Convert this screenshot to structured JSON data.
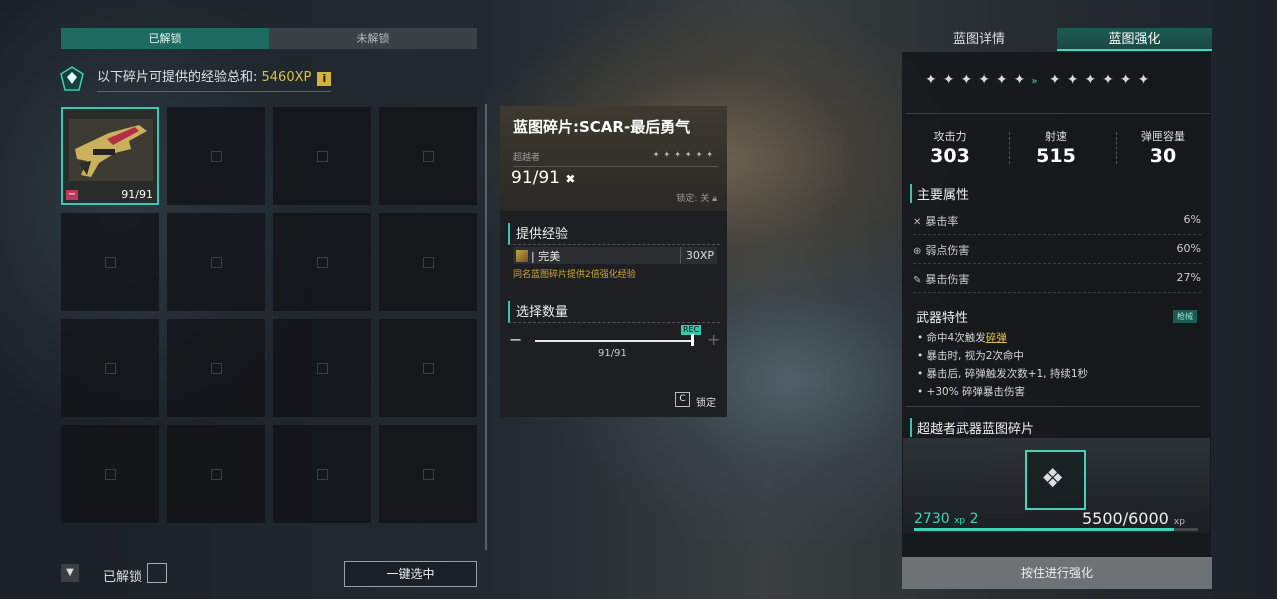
{
  "tabs": {
    "unlocked": "已解锁",
    "locked": "未解锁"
  },
  "xp_summary": {
    "label": "以下碎片可提供的经验总和: ",
    "value": "5460XP",
    "info_icon": "i"
  },
  "grid": {
    "selected_count": "91/91"
  },
  "footer": {
    "filter_icon": "▼",
    "unlocked_label": "已解锁",
    "select_all": "一键选中"
  },
  "card": {
    "title": "蓝图碎片:SCAR-最后勇气",
    "rank": "超越者",
    "count": "91/91",
    "lock_state": "锁定: 关",
    "xp_section": "提供经验",
    "xp_item_name": "完美",
    "xp_item_value": "30XP",
    "xp_note": "同名蓝图碎片提供2倍强化经验",
    "qty_section": "选择数量",
    "rec_tag": "REC",
    "slider_value": "91/91",
    "slider_fraction": 1.0,
    "lock_key": "C",
    "lock_label": "锁定"
  },
  "right": {
    "tab_details": "蓝图详情",
    "tab_enhance": "蓝图强化",
    "stats": [
      {
        "label": "攻击力",
        "value": "303"
      },
      {
        "label": "射速",
        "value": "515"
      },
      {
        "label": "弹匣容量",
        "value": "30"
      }
    ],
    "main_attr_title": "主要属性",
    "attrs": [
      {
        "name": "暴击率",
        "value": "6%",
        "icon": "crosshair-icon"
      },
      {
        "name": "弱点伤害",
        "value": "60%",
        "icon": "weakpoint-icon"
      },
      {
        "name": "暴击伤害",
        "value": "27%",
        "icon": "crit-icon"
      }
    ],
    "trait_title": "武器特性",
    "trait_badge": "枪械",
    "traits": {
      "t1_pre": "命中4次触发",
      "t1_hl": "碎弹",
      "t2": "暴击时, 视为2次命中",
      "t3": "暴击后, 碎弹触发次数+1, 持续1秒",
      "t4": "+30% 碎弹暴击伤害"
    },
    "frag_title": "超越者武器蓝图碎片",
    "xp_gain": "2730",
    "xp_unit": "xp",
    "level_gain": "2",
    "xp_progress": "5500/6000",
    "xp_progress_unit": "xp",
    "xp_fraction": 0.917,
    "enhance_button": "按住进行强化"
  }
}
